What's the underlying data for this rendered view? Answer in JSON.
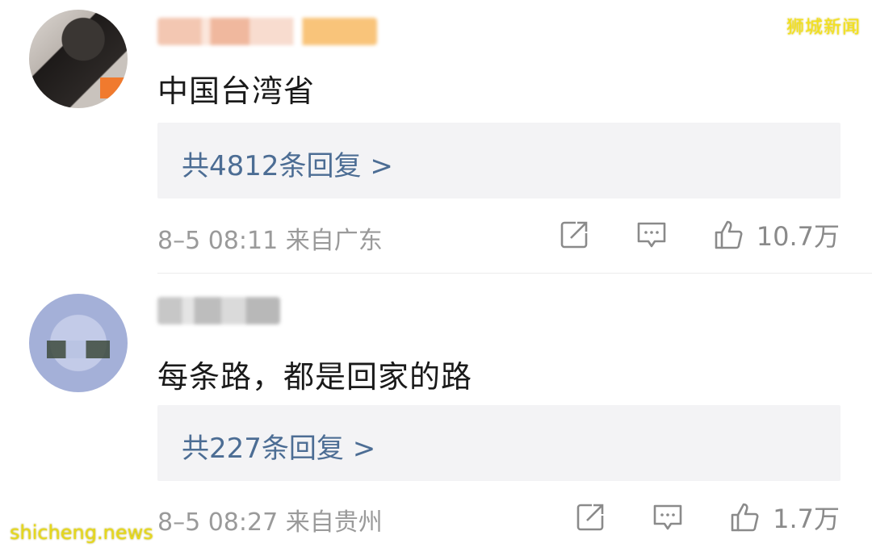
{
  "watermark": {
    "top": "狮城新闻",
    "bottom": "shicheng.news"
  },
  "comments": [
    {
      "text": "中国台湾省",
      "replies": "共4812条回复 >",
      "meta": "8–5 08:11 来自广东",
      "likes": "10.7万"
    },
    {
      "text": "每条路，都是回家的路",
      "replies": "共227条回复 >",
      "meta": "8–5 08:27 来自贵州",
      "likes": "1.7万"
    }
  ],
  "icons": [
    "share-icon",
    "comment-icon",
    "like-icon"
  ],
  "colors": {
    "reply_link": "#4c6d94",
    "reply_bg": "#f3f3f5",
    "meta": "#9a9a9a",
    "watermark": "#f4e21a"
  }
}
